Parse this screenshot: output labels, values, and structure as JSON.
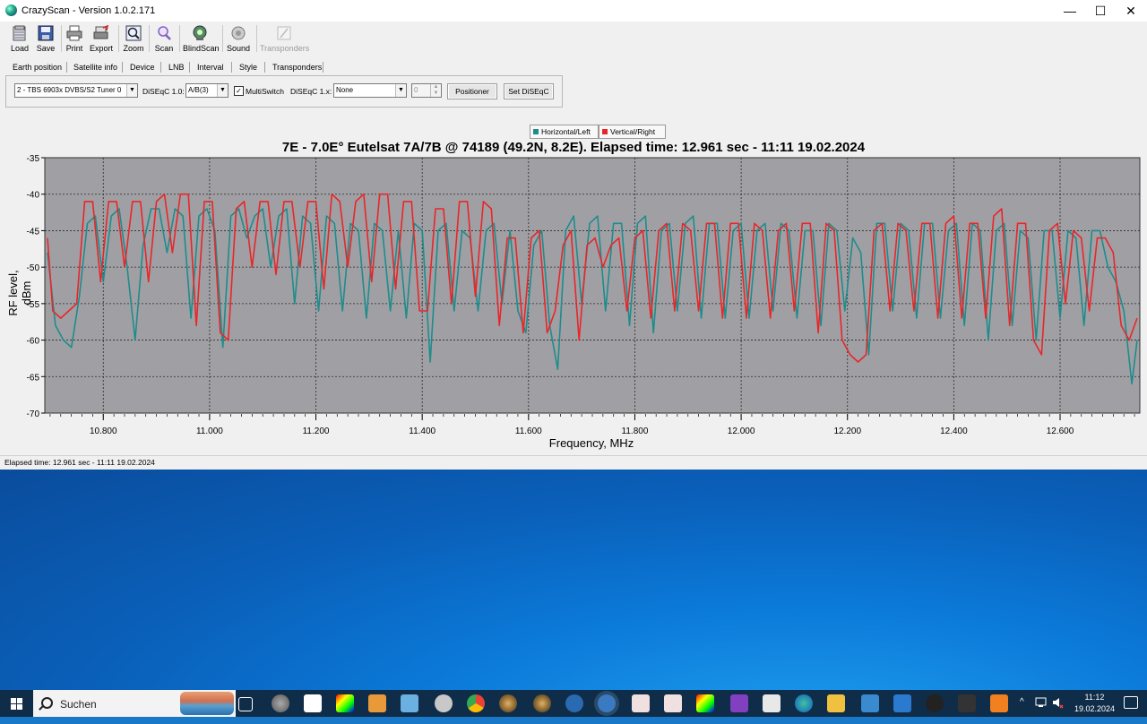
{
  "window": {
    "title": "CrazyScan - Version 1.0.2.171",
    "minimize": "—",
    "maximize": "☐",
    "close": "✕"
  },
  "toolbar": [
    {
      "label": "Load",
      "icon": "folder-icon",
      "enabled": true
    },
    {
      "label": "Save",
      "icon": "floppy-icon",
      "enabled": true
    },
    {
      "label": "Print",
      "icon": "printer-icon",
      "enabled": true
    },
    {
      "label": "Export",
      "icon": "export-icon",
      "enabled": true
    },
    {
      "label": "Zoom",
      "icon": "zoom-icon",
      "enabled": true
    },
    {
      "label": "Scan",
      "icon": "scan-icon",
      "enabled": true
    },
    {
      "label": "BlindScan",
      "icon": "blindscan-icon",
      "enabled": true
    },
    {
      "label": "Sound",
      "icon": "sound-icon",
      "enabled": true
    },
    {
      "label": "Transponders",
      "icon": "transponders-icon",
      "enabled": false
    }
  ],
  "tabs": [
    "Earth position",
    "Satellite info",
    "Device",
    "LNB",
    "Interval",
    "Style",
    "Transponders"
  ],
  "device": {
    "tuner": "2 - TBS 6903x DVBS/S2 Tuner 0",
    "diseqc10_label": "DiSEqC 1.0:",
    "diseqc10_value": "A/B(3)",
    "multiswitch_label": "MultiSwitch",
    "multiswitch_checked": true,
    "diseqc11_label": "DiSEqC 1.x:",
    "diseqc11_value": "None",
    "spin_value": "0",
    "positioner_button": "Positioner",
    "set_diseqc_button": "Set DiSEqC"
  },
  "legend": {
    "h": {
      "name": "Horizontal/Left",
      "color": "#1e8c8c"
    },
    "v": {
      "name": "Vertical/Right",
      "color": "#e8262a"
    }
  },
  "chart_data": {
    "type": "line",
    "title": "7E - 7.0E° Eutelsat 7A/7B @ 74189 (49.2N, 8.2E). Elapsed time: 12.961 sec - 11:11 19.02.2024",
    "xlabel": "Frequency, MHz",
    "ylabel": "RF level, dBm",
    "xlim": [
      10690,
      12750
    ],
    "ylim": [
      -70,
      -35
    ],
    "xticks": [
      "10.800",
      "11.000",
      "11.200",
      "11.400",
      "11.600",
      "11.800",
      "12.000",
      "12.200",
      "12.400",
      "12.600"
    ],
    "xtick_values": [
      10800,
      11000,
      11200,
      11400,
      11600,
      11800,
      12000,
      12200,
      12400,
      12600
    ],
    "yticks": [
      -35,
      -40,
      -45,
      -50,
      -55,
      -60,
      -65,
      -70
    ],
    "grid": true,
    "background": "#a0a0a4",
    "series": [
      {
        "name": "Horizontal/Left",
        "color": "#1e8c8c",
        "x": [
          10695,
          10710,
          10725,
          10740,
          10755,
          10770,
          10785,
          10800,
          10815,
          10830,
          10845,
          10860,
          10875,
          10890,
          10905,
          10920,
          10935,
          10950,
          10965,
          10980,
          10995,
          11010,
          11025,
          11040,
          11055,
          11070,
          11085,
          11100,
          11115,
          11130,
          11145,
          11160,
          11175,
          11190,
          11205,
          11220,
          11235,
          11250,
          11265,
          11280,
          11295,
          11310,
          11325,
          11340,
          11355,
          11370,
          11385,
          11400,
          11415,
          11430,
          11445,
          11460,
          11475,
          11490,
          11505,
          11520,
          11535,
          11550,
          11565,
          11580,
          11595,
          11610,
          11625,
          11640,
          11655,
          11670,
          11685,
          11700,
          11715,
          11730,
          11745,
          11760,
          11775,
          11790,
          11805,
          11820,
          11835,
          11850,
          11865,
          11880,
          11895,
          11910,
          11925,
          11940,
          11955,
          11970,
          11985,
          12000,
          12015,
          12030,
          12045,
          12060,
          12075,
          12090,
          12105,
          12120,
          12135,
          12150,
          12165,
          12180,
          12195,
          12210,
          12225,
          12240,
          12255,
          12270,
          12285,
          12300,
          12315,
          12330,
          12345,
          12360,
          12375,
          12390,
          12405,
          12420,
          12435,
          12450,
          12465,
          12480,
          12495,
          12510,
          12525,
          12540,
          12555,
          12570,
          12585,
          12600,
          12615,
          12630,
          12645,
          12660,
          12675,
          12690,
          12705,
          12720,
          12735,
          12745
        ],
        "y": [
          -48,
          -58,
          -60,
          -61,
          -54,
          -44,
          -43,
          -52,
          -43,
          -42,
          -50,
          -60,
          -47,
          -42,
          -42,
          -48,
          -42,
          -43,
          -57,
          -43,
          -42,
          -45,
          -61,
          -43,
          -42,
          -46,
          -43,
          -42,
          -50,
          -43,
          -42,
          -55,
          -43,
          -44,
          -56,
          -43,
          -44,
          -56,
          -44,
          -45,
          -57,
          -44,
          -45,
          -56,
          -45,
          -57,
          -44,
          -45,
          -63,
          -45,
          -44,
          -56,
          -45,
          -46,
          -56,
          -45,
          -44,
          -55,
          -45,
          -56,
          -59,
          -47,
          -45,
          -58,
          -64,
          -45,
          -43,
          -55,
          -44,
          -43,
          -56,
          -44,
          -44,
          -58,
          -44,
          -43,
          -59,
          -45,
          -44,
          -56,
          -44,
          -43,
          -57,
          -44,
          -44,
          -57,
          -45,
          -44,
          -57,
          -45,
          -44,
          -56,
          -44,
          -45,
          -57,
          -45,
          -45,
          -58,
          -44,
          -45,
          -56,
          -46,
          -48,
          -62,
          -44,
          -44,
          -56,
          -44,
          -45,
          -57,
          -44,
          -44,
          -57,
          -45,
          -44,
          -58,
          -44,
          -45,
          -60,
          -45,
          -44,
          -58,
          -45,
          -46,
          -60,
          -45,
          -45,
          -57,
          -45,
          -46,
          -58,
          -45,
          -45,
          -50,
          -52,
          -56,
          -66,
          -60
        ]
      },
      {
        "name": "Vertical/Right",
        "color": "#e8262a",
        "x": [
          10695,
          10705,
          10720,
          10735,
          10750,
          10765,
          10780,
          10795,
          10810,
          10825,
          10840,
          10855,
          10870,
          10885,
          10900,
          10915,
          10930,
          10945,
          10960,
          10975,
          10990,
          11005,
          11020,
          11035,
          11050,
          11065,
          11080,
          11095,
          11110,
          11125,
          11140,
          11155,
          11170,
          11185,
          11200,
          11215,
          11230,
          11245,
          11260,
          11275,
          11290,
          11305,
          11320,
          11335,
          11350,
          11365,
          11380,
          11395,
          11410,
          11425,
          11440,
          11455,
          11470,
          11485,
          11500,
          11515,
          11530,
          11545,
          11560,
          11575,
          11590,
          11605,
          11620,
          11635,
          11650,
          11665,
          11680,
          11695,
          11710,
          11725,
          11740,
          11755,
          11770,
          11785,
          11800,
          11815,
          11830,
          11845,
          11860,
          11875,
          11890,
          11905,
          11920,
          11935,
          11950,
          11965,
          11980,
          11995,
          12010,
          12025,
          12040,
          12055,
          12070,
          12085,
          12100,
          12115,
          12130,
          12145,
          12160,
          12175,
          12190,
          12205,
          12220,
          12235,
          12250,
          12265,
          12280,
          12295,
          12310,
          12325,
          12340,
          12355,
          12370,
          12385,
          12400,
          12415,
          12430,
          12445,
          12460,
          12475,
          12490,
          12505,
          12520,
          12535,
          12550,
          12565,
          12580,
          12595,
          12610,
          12625,
          12640,
          12655,
          12670,
          12685,
          12700,
          12715,
          12730,
          12745
        ],
        "y": [
          -46,
          -56,
          -57,
          -56,
          -55,
          -41,
          -41,
          -52,
          -41,
          -41,
          -50,
          -41,
          -41,
          -52,
          -41,
          -40,
          -48,
          -40,
          -40,
          -58,
          -41,
          -41,
          -59,
          -60,
          -42,
          -41,
          -50,
          -41,
          -41,
          -51,
          -41,
          -41,
          -50,
          -41,
          -41,
          -53,
          -40,
          -41,
          -50,
          -41,
          -40,
          -52,
          -40,
          -40,
          -53,
          -41,
          -41,
          -56,
          -56,
          -42,
          -42,
          -55,
          -41,
          -41,
          -54,
          -41,
          -42,
          -58,
          -46,
          -46,
          -59,
          -46,
          -45,
          -59,
          -56,
          -47,
          -45,
          -60,
          -47,
          -46,
          -50,
          -47,
          -46,
          -56,
          -46,
          -45,
          -57,
          -45,
          -44,
          -56,
          -44,
          -45,
          -56,
          -44,
          -44,
          -57,
          -44,
          -44,
          -57,
          -44,
          -45,
          -57,
          -45,
          -44,
          -56,
          -44,
          -44,
          -59,
          -44,
          -45,
          -60,
          -62,
          -63,
          -62,
          -45,
          -44,
          -56,
          -44,
          -45,
          -56,
          -44,
          -44,
          -57,
          -44,
          -43,
          -57,
          -44,
          -44,
          -57,
          -43,
          -42,
          -58,
          -44,
          -44,
          -60,
          -62,
          -45,
          -44,
          -55,
          -45,
          -46,
          -56,
          -46,
          -46,
          -48,
          -58,
          -60,
          -57
        ]
      }
    ]
  },
  "status": "Elapsed time: 12.961 sec - 11:11 19.02.2024",
  "taskbar": {
    "search_label": "Suchen",
    "clock_time": "11:12",
    "clock_date": "19.02.2024"
  }
}
